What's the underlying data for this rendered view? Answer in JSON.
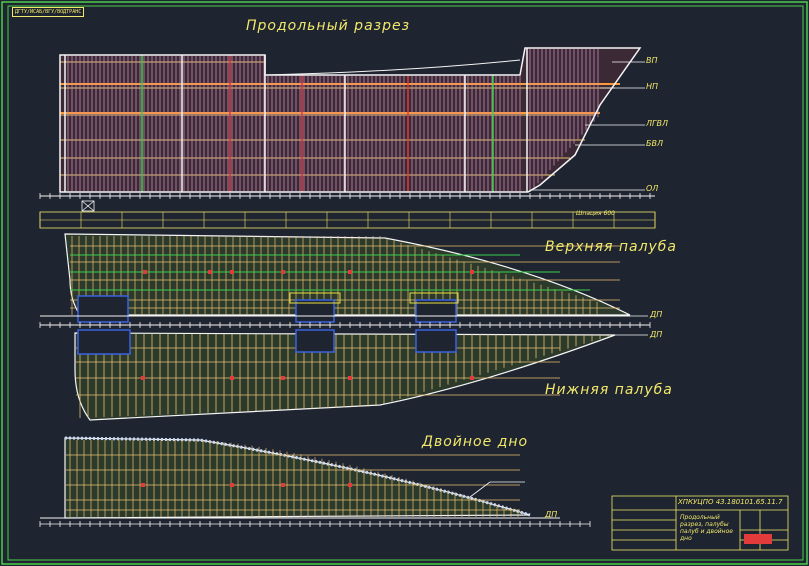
{
  "stamp": "ДГТУ/ИСАБ/ВГУ/ВОДТРАНС",
  "views": {
    "profile_title": "Продольный разрез",
    "upper_deck_title": "Верхняя палуба",
    "lower_deck_title": "Нижняя палуба",
    "double_bottom_title": "Двойное дно"
  },
  "deck_labels": {
    "vp": "ВП",
    "np": "НП",
    "lgvl": "ЛГВЛ",
    "bvl": "БВЛ",
    "ol": "ОЛ",
    "dp_upper": "ДП",
    "dp_lower": "ДП",
    "dp_bottom": "ДП"
  },
  "spacing_label": "Шпация 600",
  "title_block": {
    "code": "ХПКУЦПО 43.180101.65.11.7",
    "name": "Продольный разрез, палубы палуб и двойное дно"
  },
  "colors": {
    "background": "#1e2430",
    "frame": "#4ad04a",
    "hull": "#f5f5f5",
    "fill": "#e8c070",
    "accent_red": "#e23b3b",
    "accent_blue": "#3a63e0",
    "label": "#f2e86b"
  }
}
